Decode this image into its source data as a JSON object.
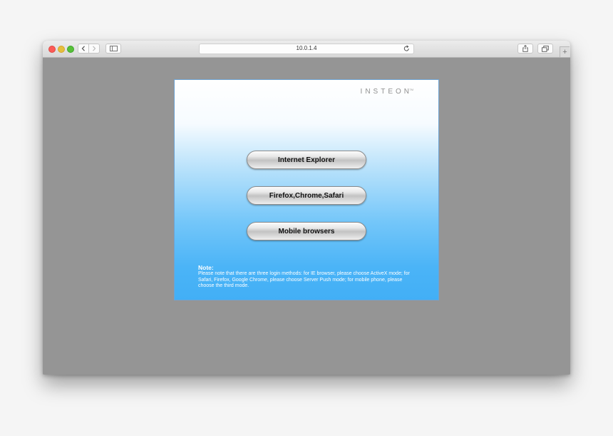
{
  "browser": {
    "address": "10.0.1.4",
    "icons": {
      "back": "chevron-left-icon",
      "forward": "chevron-right-icon",
      "sidebar": "sidebar-icon",
      "reload": "reload-icon",
      "share": "share-icon",
      "tabs": "tabs-overview-icon",
      "new_tab": "plus-icon"
    },
    "new_tab_glyph": "+"
  },
  "page": {
    "logo": "INSTEON",
    "logo_tm": "TM",
    "buttons": [
      {
        "label": "Internet Explorer"
      },
      {
        "label": "Firefox,Chrome,Safari"
      },
      {
        "label": "Mobile browsers"
      }
    ],
    "note": {
      "title": "Note:",
      "text": "Please note that there are three login methods: for IE browser, please choose ActiveX mode; for Safari, Firefox, Google Chrome, please choose Server Push mode; for mobile phone, please choose the third mode."
    }
  },
  "colors": {
    "close": "#fc5b57",
    "minimize": "#e5bf3c",
    "maximize": "#57c038",
    "panel_top": "#ffffff",
    "panel_bottom": "#42aff6",
    "page_background": "#959595"
  }
}
